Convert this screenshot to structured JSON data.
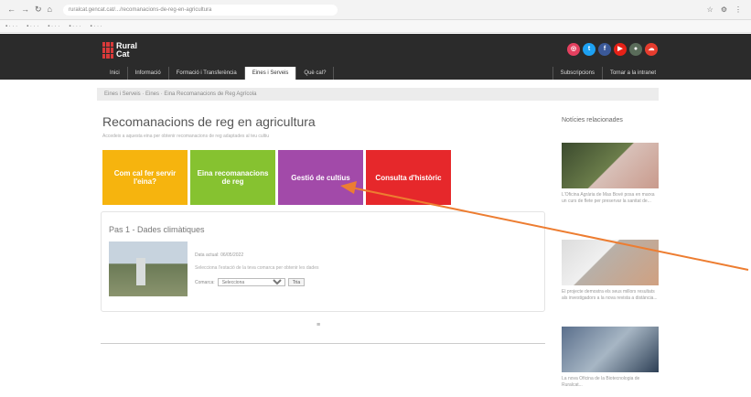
{
  "browser": {
    "url": "ruralcat.gencat.cat/.../recomanacions-de-reg-en-agricultura"
  },
  "header": {
    "logo_line1": "Rural",
    "logo_line2": "Cat",
    "social_icons": [
      "instagram-icon",
      "twitter-icon",
      "facebook-icon",
      "youtube-icon",
      "flickr-icon",
      "rss-icon"
    ],
    "menu": [
      "Inici",
      "Informació",
      "Formació i Transferència",
      "Eines i Serveis",
      "Què cal?"
    ],
    "menu_active_index": 3,
    "menu_right": [
      "Subscripcions",
      "Tornar a la intranet"
    ]
  },
  "breadcrumb": "Eines i Serveis · Eines · Eina Recomanacions de Reg Agrícola",
  "page": {
    "title": "Recomanacions de reg en agricultura",
    "subtitle": "Accedeix a aquesta eina per obtenir recomanacions de reg adaptades al teu cultiu"
  },
  "tiles": [
    {
      "label": "Com cal fer servir l'eina?",
      "color": "#f6b40e"
    },
    {
      "label": "Eina recomanacions de reg",
      "color": "#86c230"
    },
    {
      "label": "Gestió de cultius",
      "color": "#a24aa9"
    },
    {
      "label": "Consulta d'històric",
      "color": "#e6282b"
    }
  ],
  "panel": {
    "step_title": "Pas 1 - Dades climàtiques",
    "date_line": "Data actual: 06/05/2022",
    "info_line": "Selecciona l'estació de la teva comarca per obtenir les dades",
    "comarca_label": "Comarca:",
    "select_value": "Selecciona",
    "go_button": "Tria"
  },
  "pager": "≡",
  "sidebar": {
    "title": "Notícies relacionades",
    "items": [
      "L'Oficina Agrària de Mas Bové posa en marxa un curs de flete per preservar la sanitat de...",
      "El projecte demostra els seus millors resultats als investigadors a la nova revista a distància...",
      "La nova Oficina de la Biotecnologia de Ruralcat..."
    ]
  },
  "colors": {
    "header_bg": "#2b2b2b",
    "arrow": "#ed7d31"
  }
}
